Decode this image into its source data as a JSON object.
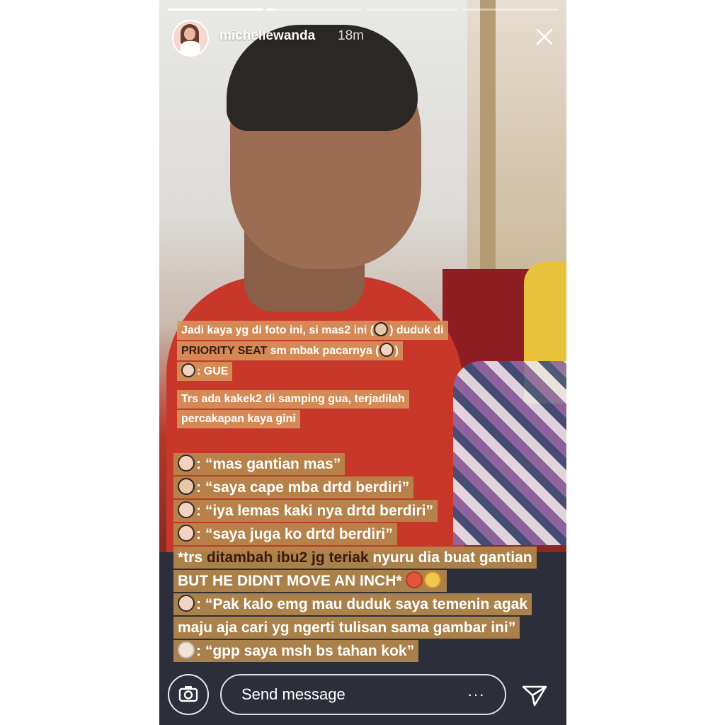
{
  "story": {
    "progress": [
      1,
      0.1,
      0,
      0,
      0
    ],
    "username": "michellewanda",
    "time": "18m"
  },
  "captions": {
    "intro": {
      "line1": "Jadi kaya yg di foto ini, si mas2 ini (",
      "line1_end": ") duduk di",
      "line2_highlight": "PRIORITY SEAT",
      "line2_rest": " sm mbak pacarnya (",
      "line2_end": ")",
      "line3": ": GUE"
    },
    "context": {
      "line1": "Trs ada kakek2 di samping gua, terjadilah",
      "line2": "percakapan kaya gini"
    },
    "dialog": [
      {
        "emoji": "woman-raising-hand",
        "text": ": “mas gantian mas”"
      },
      {
        "emoji": "man",
        "text": ": “saya cape mba drtd berdiri”"
      },
      {
        "emoji": "woman",
        "text": ": “iya lemas kaki nya drtd berdiri”"
      },
      {
        "emoji": "woman-raising-hand",
        "text": ": “saya juga ko drtd berdiri”"
      }
    ],
    "narration": {
      "part1": "*trs ",
      "highlight": "ditambah ibu2 jg teriak",
      "part2": " nyuru dia buat gantian",
      "line2": "BUT HE DIDNT MOVE AN INCH* "
    },
    "request": {
      "line1": ": “Pak kalo emg mau duduk saya temenin agak",
      "line2": "maju aja cari yg ngerti tulisan sama gambar ini”"
    },
    "reply": {
      "emoji": "old-man",
      "text": ": “gpp saya msh bs tahan kok”"
    }
  },
  "bottom_bar": {
    "placeholder": "Send message",
    "more": "···"
  },
  "icons": {
    "close": "close-icon",
    "camera": "camera-icon",
    "share": "paper-plane-icon",
    "emoji_angry": "angry-face-icon",
    "emoji_steam": "steam-face-icon"
  }
}
